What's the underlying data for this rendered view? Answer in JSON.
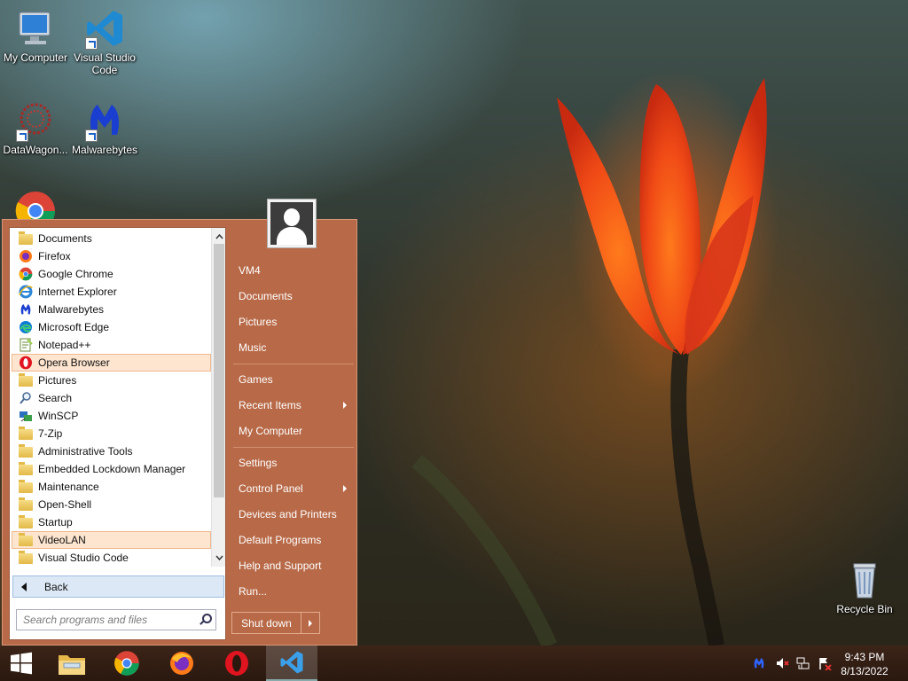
{
  "desktop": {
    "icons": [
      {
        "label": "My Computer",
        "icon": "monitor-icon"
      },
      {
        "label": "Visual Studio Code",
        "icon": "vscode-icon"
      },
      {
        "label": "DataWagon...",
        "icon": "datawagon-icon"
      },
      {
        "label": "Malwarebytes",
        "icon": "malwarebytes-icon"
      },
      {
        "label": "Recycle Bin",
        "icon": "recycle-bin-icon"
      }
    ]
  },
  "start_menu": {
    "programs": [
      {
        "label": "Documents",
        "icon": "folder-icon"
      },
      {
        "label": "Firefox",
        "icon": "firefox-icon"
      },
      {
        "label": "Google Chrome",
        "icon": "chrome-icon"
      },
      {
        "label": "Internet Explorer",
        "icon": "ie-icon"
      },
      {
        "label": "Malwarebytes",
        "icon": "malwarebytes-icon"
      },
      {
        "label": "Microsoft Edge",
        "icon": "edge-icon"
      },
      {
        "label": "Notepad++",
        "icon": "notepad-icon"
      },
      {
        "label": "Opera Browser",
        "icon": "opera-icon",
        "highlighted": true
      },
      {
        "label": "Pictures",
        "icon": "folder-icon"
      },
      {
        "label": "Search",
        "icon": "search-icon"
      },
      {
        "label": "WinSCP",
        "icon": "winscp-icon"
      },
      {
        "label": "7-Zip",
        "icon": "folder-icon"
      },
      {
        "label": "Administrative Tools",
        "icon": "folder-icon"
      },
      {
        "label": "Embedded Lockdown Manager",
        "icon": "folder-icon"
      },
      {
        "label": "Maintenance",
        "icon": "folder-icon"
      },
      {
        "label": "Open-Shell",
        "icon": "folder-icon"
      },
      {
        "label": "Startup",
        "icon": "folder-icon"
      },
      {
        "label": "VideoLAN",
        "icon": "folder-icon",
        "highlighted": true
      },
      {
        "label": "Visual Studio Code",
        "icon": "folder-icon"
      }
    ],
    "back_label": "Back",
    "search_placeholder": "Search programs and files",
    "right_items": {
      "user": "VM4",
      "documents": "Documents",
      "pictures": "Pictures",
      "music": "Music",
      "games": "Games",
      "recent_items": "Recent Items",
      "my_computer": "My Computer",
      "settings": "Settings",
      "control_panel": "Control Panel",
      "devices_printers": "Devices and Printers",
      "default_programs": "Default Programs",
      "help_support": "Help and Support",
      "run": "Run..."
    },
    "shutdown_label": "Shut down"
  },
  "taskbar": {
    "pinned": [
      "windows-start-icon",
      "file-explorer-icon",
      "chrome-icon",
      "firefox-icon",
      "opera-icon",
      "vscode-icon"
    ],
    "tray": [
      "malwarebytes-tray-icon",
      "volume-muted-icon",
      "network-icon",
      "action-center-icon"
    ],
    "time": "9:43 PM",
    "date": "8/13/2022"
  },
  "colors": {
    "menu_accent": "#b86a48",
    "highlight": "#fde5cf",
    "taskbar": "#2c1a12"
  }
}
